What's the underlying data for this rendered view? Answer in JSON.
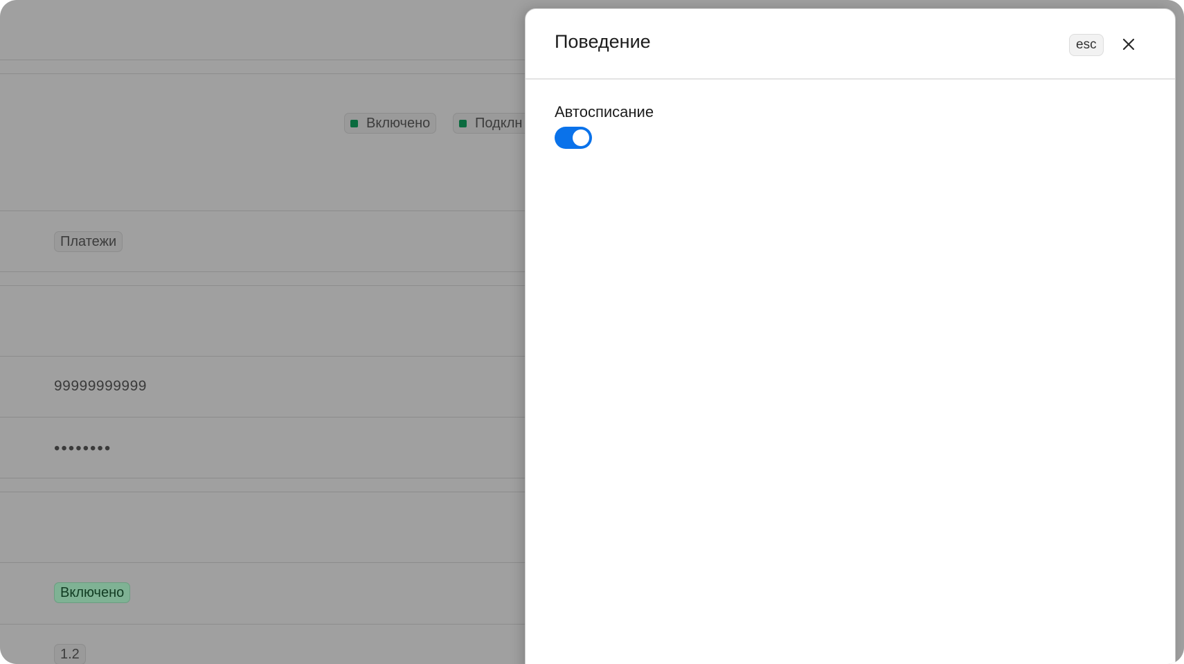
{
  "background_page": {
    "status_pills": [
      {
        "label": "Включено",
        "dot_color": "#0b6b3f"
      },
      {
        "label": "Подклн"
      }
    ],
    "payments_tag": "Платежи",
    "account_number": "99999999999",
    "masked_password": "••••••••",
    "enabled_tag": "Включено",
    "version_tag": "1.2"
  },
  "drawer": {
    "title": "Поведение",
    "esc_label": "esc",
    "close_icon": "close-icon",
    "fields": [
      {
        "label": "Автосписание",
        "type": "toggle",
        "value": true
      }
    ]
  },
  "colors": {
    "accent": "#0a72ea",
    "overlay": "#a0a0a0",
    "enabled_green": "#0b6b3f"
  }
}
